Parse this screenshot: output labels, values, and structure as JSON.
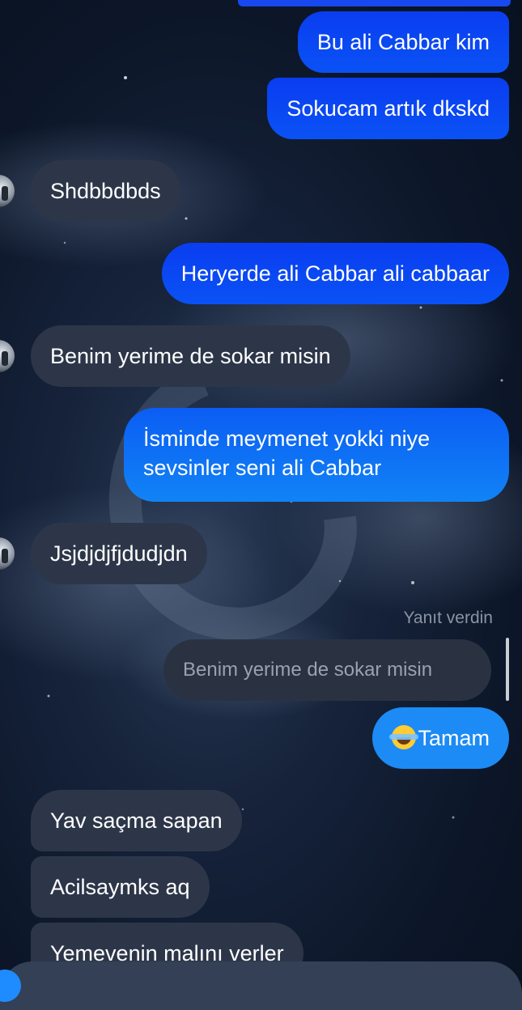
{
  "messages": [
    {
      "direction": "outgoing",
      "text": "Bu ali Cabbar kim"
    },
    {
      "direction": "outgoing",
      "text": "Sokucam artık dkskd"
    },
    {
      "direction": "incoming",
      "text": "Shdbbdbds"
    },
    {
      "direction": "outgoing",
      "text": "Heryerde ali Cabbar ali cabbaar"
    },
    {
      "direction": "incoming",
      "text": "Benim yerime de sokar misin"
    },
    {
      "direction": "outgoing",
      "text_line1": "İsminde meymenet yokki niye",
      "text_line2": "sevsinler seni ali Cabbar"
    },
    {
      "direction": "incoming",
      "text": "Jsjdjdjfjdudjdn"
    },
    {
      "direction": "outgoing",
      "text": "Tamam",
      "emoji": "face-with-tears-of-joy-icon"
    },
    {
      "direction": "incoming",
      "text": "Yav saçma sapan"
    },
    {
      "direction": "incoming",
      "text": "Acilsaymks aq"
    },
    {
      "direction": "incoming",
      "text": "Yemevenin malını verler"
    }
  ],
  "reply": {
    "label": "Yanıt verdin",
    "quoted_text": "Benim yerime de sokar misin"
  },
  "colors": {
    "outgoing": "#0a46f2",
    "outgoing_light": "#1c8bf5",
    "incoming": "#2d3649",
    "background": "#0c1628"
  }
}
